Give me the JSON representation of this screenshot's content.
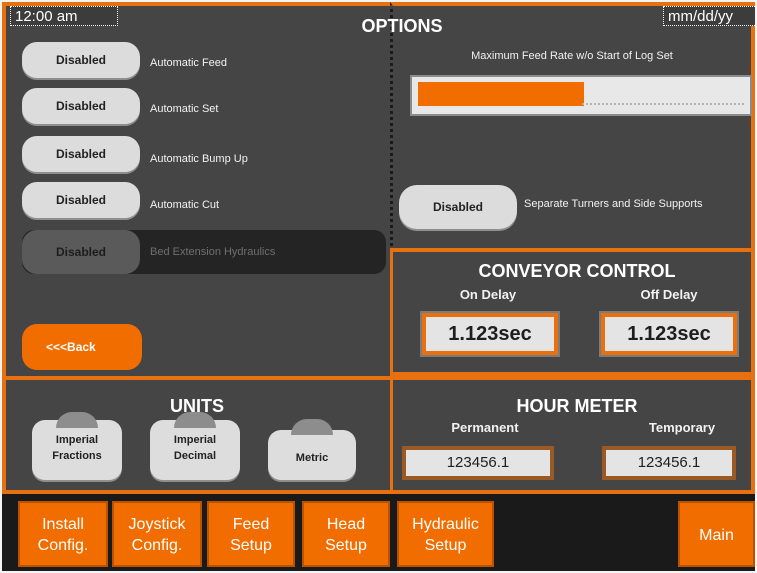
{
  "header": {
    "time": "12:00 am",
    "title": "OPTIONS",
    "date": "mm/dd/yy"
  },
  "options": [
    {
      "status": "Disabled",
      "label": "Automatic Feed"
    },
    {
      "status": "Disabled",
      "label": "Automatic Set"
    },
    {
      "status": "Disabled",
      "label": "Automatic Bump Up"
    },
    {
      "status": "Disabled",
      "label": "Automatic Cut"
    },
    {
      "status": "Disabled",
      "label": "Bed Extension Hydraulics"
    }
  ],
  "back_button": "<<<Back",
  "feed_rate": {
    "label": "Maximum Feed Rate w/o Start of Log Set",
    "level_fraction": 0.49
  },
  "separate_turners": {
    "status": "Disabled",
    "label": "Separate Turners and Side Supports"
  },
  "conveyor": {
    "title": "CONVEYOR CONTROL",
    "on_delay_label": "On Delay",
    "off_delay_label": "Off Delay",
    "on_delay_value": "1.123sec",
    "off_delay_value": "1.123sec"
  },
  "units": {
    "title": "UNITS",
    "buttons": [
      {
        "line1": "Imperial",
        "line2": "Fractions"
      },
      {
        "line1": "Imperial",
        "line2": "Decimal"
      },
      {
        "line1": "Metric",
        "line2": ""
      }
    ]
  },
  "hour_meter": {
    "title": "HOUR METER",
    "permanent_label": "Permanent",
    "temporary_label": "Temporary",
    "permanent_value": "123456.1",
    "temporary_value": "123456.1"
  },
  "nav": [
    {
      "line1": "Install",
      "line2": "Config."
    },
    {
      "line1": "Joystick",
      "line2": "Config."
    },
    {
      "line1": "Feed",
      "line2": "Setup"
    },
    {
      "line1": "Head",
      "line2": "Setup"
    },
    {
      "line1": "Hydraulic",
      "line2": "Setup"
    },
    {
      "line1": "Main",
      "line2": ""
    }
  ],
  "colors": {
    "accent_orange": "#f26d00",
    "panel_gray": "#454545",
    "button_gray": "#dcdcdc"
  }
}
